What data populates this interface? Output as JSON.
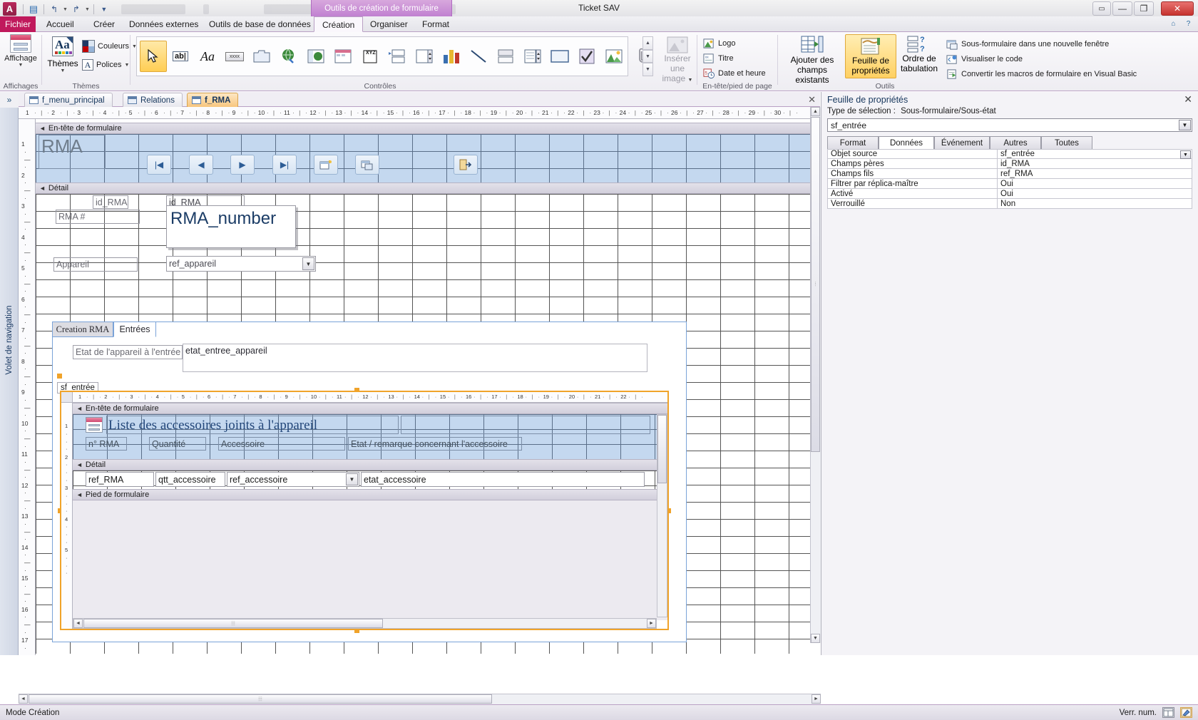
{
  "window": {
    "title": "Ticket SAV",
    "app_icon": "A",
    "contextual_tab_banner": "Outils de création de formulaire",
    "quick_access": [
      "save-icon",
      "undo-icon",
      "redo-icon",
      "customize-icon"
    ],
    "controls": {
      "minimize": "—",
      "maximize": "▭",
      "restore": "❐",
      "close": "✕"
    }
  },
  "ribbon": {
    "tabs": [
      {
        "label": "Fichier",
        "active": false,
        "file": true
      },
      {
        "label": "Accueil",
        "active": false
      },
      {
        "label": "Créer",
        "active": false
      },
      {
        "label": "Données externes",
        "active": false
      },
      {
        "label": "Outils de base de données",
        "active": false
      },
      {
        "label": "Création",
        "active": true
      },
      {
        "label": "Organiser",
        "active": false
      },
      {
        "label": "Format",
        "active": false
      }
    ],
    "help_icons": [
      "minimize-ribbon-icon",
      "help-icon"
    ],
    "groups": [
      {
        "name": "Affichages",
        "label": "Affichages"
      },
      {
        "name": "Themes",
        "label": "Thèmes"
      },
      {
        "name": "Controles",
        "label": "Contrôles"
      },
      {
        "name": "EnteteFooter",
        "label": "En-tête/pied de page"
      },
      {
        "name": "Outils",
        "label": "Outils"
      }
    ],
    "affichages": {
      "button_label": "Affichage",
      "icon": "view-icon"
    },
    "themes": {
      "themes_label": "Thèmes",
      "colors_label": "Couleurs",
      "fonts_label": "Polices"
    },
    "controls_gallery": [
      "select-pointer-icon",
      "textbox-icon",
      "label-icon",
      "button-icon",
      "tab-control-icon",
      "hyperlink-icon",
      "web-browser-icon",
      "navigation-control-icon",
      "page-break-icon",
      "combo-box-icon",
      "list-box-icon",
      "chart-icon",
      "line-icon",
      "toggle-button-icon",
      "subform-icon",
      "rectangle-icon",
      "check-box-icon",
      "image-icon",
      "attachment-icon"
    ],
    "insert_image": {
      "label_line1": "Insérer une",
      "label_line2": "image"
    },
    "header_footer": [
      {
        "label": "Logo",
        "icon": "logo-icon"
      },
      {
        "label": "Titre",
        "icon": "title-icon"
      },
      {
        "label": "Date et heure",
        "icon": "date-time-icon"
      }
    ],
    "tools": {
      "add_fields": {
        "line1": "Ajouter des",
        "line2": "champs existants",
        "icon": "add-existing-fields-icon"
      },
      "property_sheet": {
        "line1": "Feuille de",
        "line2": "propriétés",
        "icon": "property-sheet-icon",
        "active": true
      },
      "tab_order": {
        "line1": "Ordre de",
        "line2": "tabulation",
        "icon": "tab-order-icon"
      },
      "small_items": [
        {
          "label": "Sous-formulaire dans une nouvelle fenêtre",
          "icon": "subform-new-window-icon"
        },
        {
          "label": "Visualiser le code",
          "icon": "view-code-icon"
        },
        {
          "label": "Convertir les macros de formulaire en Visual Basic",
          "icon": "convert-macros-icon"
        }
      ]
    }
  },
  "navigation_pane": {
    "label": "Volet de navigation",
    "expand_icon": "chevron-double-right-icon"
  },
  "document_tabs": [
    {
      "label": "f_menu_principal",
      "icon": "form-icon",
      "active": false
    },
    {
      "label": "Relations",
      "icon": "relations-icon",
      "active": false
    },
    {
      "label": "f_RMA",
      "icon": "form-icon",
      "active": true
    }
  ],
  "form": {
    "sections": {
      "header": "En-tête de formulaire",
      "detail": "Détail"
    },
    "header_title": "RMA",
    "nav_buttons": [
      "first-record-icon",
      "previous-record-icon",
      "next-record-icon",
      "last-record-icon",
      "new-record-icon",
      "save-record-icon",
      "exit-icon"
    ],
    "detail_controls": {
      "id_rma_label": "id_RMA",
      "id_rma_field": "id_RMA",
      "rma_hash_label": "RMA #",
      "rma_number_box": "RMA_number",
      "appareil_label": "Appareil",
      "ref_appareil_field": "ref_appareil"
    },
    "tab_control": {
      "tabs": [
        {
          "label": "Creation RMA",
          "active": false
        },
        {
          "label": "Entrées",
          "active": true
        }
      ]
    },
    "entree_page": {
      "etat_label": "Etat de l'appareil à l'entrée",
      "etat_field": "etat_entree_appareil"
    }
  },
  "subform": {
    "name_label": "sf_entrée",
    "sections": {
      "header": "En-tête de formulaire",
      "detail": "Détail",
      "footer": "Pied de formulaire"
    },
    "title": "Liste des accessoires joints à l'appareil",
    "title_icon": "form-header-icon",
    "column_headers": [
      "n° RMA",
      "Quantité",
      "Accessoire",
      "Etat / remarque concernant l'accessoire"
    ],
    "detail_fields": [
      {
        "name": "ref_RMA",
        "type": "textbox"
      },
      {
        "name": "qtt_accessoire",
        "type": "textbox"
      },
      {
        "name": "ref_accessoire",
        "type": "combobox"
      },
      {
        "name": "etat_accessoire",
        "type": "textbox"
      }
    ]
  },
  "property_sheet": {
    "title": "Feuille de propriétés",
    "close_icon": "close-icon",
    "selection_type_label": "Type de sélection :",
    "selection_type_value": "Sous-formulaire/Sous-état",
    "selected_object": "sf_entrée",
    "tabs": [
      {
        "label": "Format",
        "active": false
      },
      {
        "label": "Données",
        "active": true
      },
      {
        "label": "Événement",
        "active": false
      },
      {
        "label": "Autres",
        "active": false
      },
      {
        "label": "Toutes",
        "active": false
      }
    ],
    "rows": [
      {
        "name": "Objet source",
        "value": "sf_entrée",
        "has_dropdown": true
      },
      {
        "name": "Champs pères",
        "value": "id_RMA",
        "has_dropdown": false
      },
      {
        "name": "Champs fils",
        "value": "ref_RMA",
        "has_dropdown": false
      },
      {
        "name": "Filtrer par réplica-maître",
        "value": "Oui",
        "has_dropdown": false
      },
      {
        "name": "Activé",
        "value": "Oui",
        "has_dropdown": false
      },
      {
        "name": "Verrouillé",
        "value": "Non",
        "has_dropdown": false
      }
    ]
  },
  "status_bar": {
    "mode": "Mode Création",
    "num_lock": "Verr. num.",
    "view_buttons": [
      "form-view-icon",
      "design-view-icon"
    ]
  },
  "rulers": {
    "horizontal_ticks": [
      "1",
      "2",
      "3",
      "4",
      "5",
      "6",
      "7",
      "8",
      "9",
      "10",
      "11",
      "12",
      "13",
      "14",
      "15",
      "16",
      "17",
      "18",
      "19",
      "20",
      "21",
      "22",
      "23",
      "24",
      "25",
      "26",
      "27",
      "28",
      "29",
      "30"
    ],
    "subform_ticks": [
      "1",
      "2",
      "3",
      "4",
      "5",
      "6",
      "7",
      "8",
      "9",
      "10",
      "11",
      "12",
      "13",
      "14",
      "15",
      "16",
      "17",
      "18",
      "19",
      "20",
      "21",
      "22"
    ],
    "vertical_ticks": [
      "1",
      "2",
      "3",
      "4",
      "5",
      "6",
      "7",
      "8",
      "9",
      "10",
      "11",
      "12",
      "13",
      "14",
      "15",
      "16",
      "17"
    ],
    "subform_vertical_ticks": [
      "1",
      "2",
      "3",
      "4",
      "5"
    ]
  },
  "colors": {
    "accent_purple": "#b07fc4",
    "file_tab": "#c0195c",
    "active_doc_tab": "#f8c67e",
    "header_section": "#c4d8ef",
    "selection_orange": "#f0a32a",
    "title_blue": "#23477a"
  }
}
